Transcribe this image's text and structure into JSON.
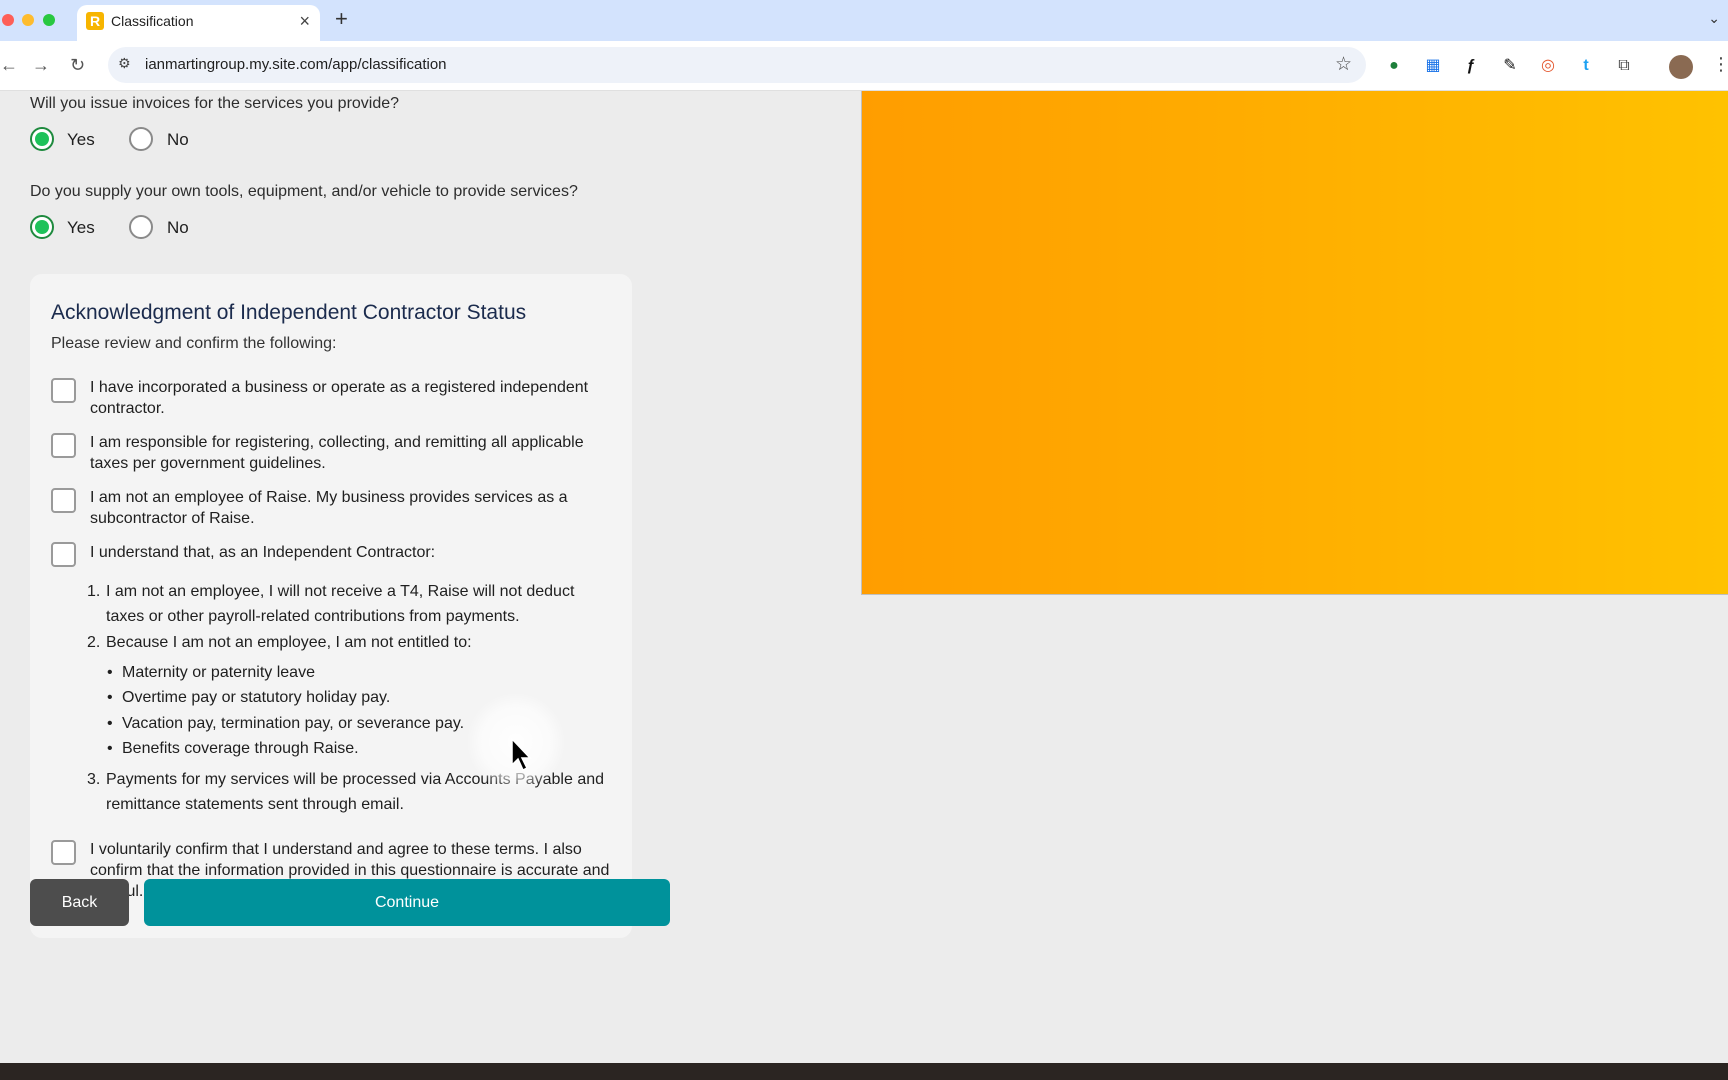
{
  "browser": {
    "tab_title": "Classification",
    "tab_favicon": "R",
    "new_tab_symbol": "+",
    "url": "ianmartingroup.my.site.com/app/classification",
    "extensions": [
      "palette-icon",
      "grid-icon",
      "script-icon",
      "dropper-icon",
      "ring-icon",
      "t-icon",
      "puzzle-icon"
    ]
  },
  "questions": [
    {
      "text": "Will you issue invoices for the services you provide?",
      "options": [
        "Yes",
        "No"
      ],
      "selected": "Yes"
    },
    {
      "text": "Do you supply your own tools, equipment, and/or vehicle to provide services?",
      "options": [
        "Yes",
        "No"
      ],
      "selected": "Yes"
    }
  ],
  "acknowledgment": {
    "title": "Acknowledgment of Independent Contractor Status",
    "subtitle": "Please review and confirm the following:",
    "items": [
      "I have incorporated a business or operate as a registered independent contractor.",
      "I am responsible for registering, collecting, and remitting all applicable taxes per government guidelines.",
      "I am not an employee of Raise. My business provides services as a subcontractor of Raise.",
      "I understand that, as an Independent Contractor:"
    ],
    "terms": [
      {
        "num": "1.",
        "text": "I am not an employee, I will not receive a T4, Raise will not deduct taxes or other payroll-related contributions from payments."
      },
      {
        "num": "2.",
        "text": "Because I am not an employee, I am not entitled to:"
      },
      {
        "num": "3.",
        "text": "Payments for my services will be processed via Accounts Payable and remittance statements sent through email."
      }
    ],
    "not_entitled": [
      "Maternity or paternity leave",
      "Overtime pay or statutory holiday pay.",
      "Vacation pay, termination pay, or severance pay.",
      "Benefits coverage through Raise."
    ],
    "final_confirmation": "I voluntarily confirm that I understand and agree to these terms. I also confirm that the information provided in this questionnaire is accurate and truthful."
  },
  "buttons": {
    "back": "Back",
    "continue": "Continue"
  },
  "colors": {
    "accent": "#00929b",
    "selected_radio": "#1ec25a",
    "hero_start": "#ff9d00",
    "hero_end": "#ffc200",
    "back_button": "#4d4d4d"
  }
}
